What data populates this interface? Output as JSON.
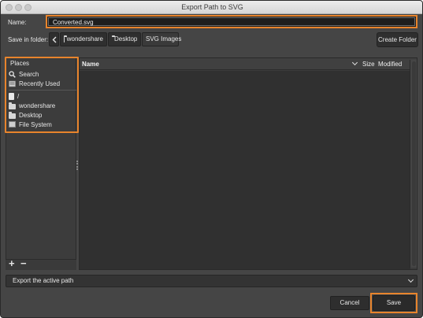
{
  "window": {
    "title": "Export Path to SVG"
  },
  "name_field": {
    "label": "Name:",
    "value": "Converted.svg"
  },
  "save_in": {
    "label": "Save in folder:",
    "crumbs": [
      "wondershare",
      "Desktop",
      "SVG Images"
    ],
    "create_folder": "Create Folder"
  },
  "places": {
    "header": "Places",
    "items": [
      {
        "label": "Search",
        "icon": "search-icon"
      },
      {
        "label": "Recently Used",
        "icon": "recent-icon"
      },
      {
        "label": "/",
        "icon": "file-icon"
      },
      {
        "label": "wondershare",
        "icon": "folder-icon"
      },
      {
        "label": "Desktop",
        "icon": "folder-icon"
      },
      {
        "label": "File System",
        "icon": "drive-icon"
      }
    ],
    "add": "+",
    "remove": "−"
  },
  "files": {
    "columns": {
      "name": "Name",
      "size": "Size",
      "modified": "Modified"
    }
  },
  "filter": {
    "value": "Export the active path"
  },
  "buttons": {
    "cancel": "Cancel",
    "save": "Save"
  },
  "colors": {
    "highlight": "#e8842c",
    "background": "#454545"
  }
}
